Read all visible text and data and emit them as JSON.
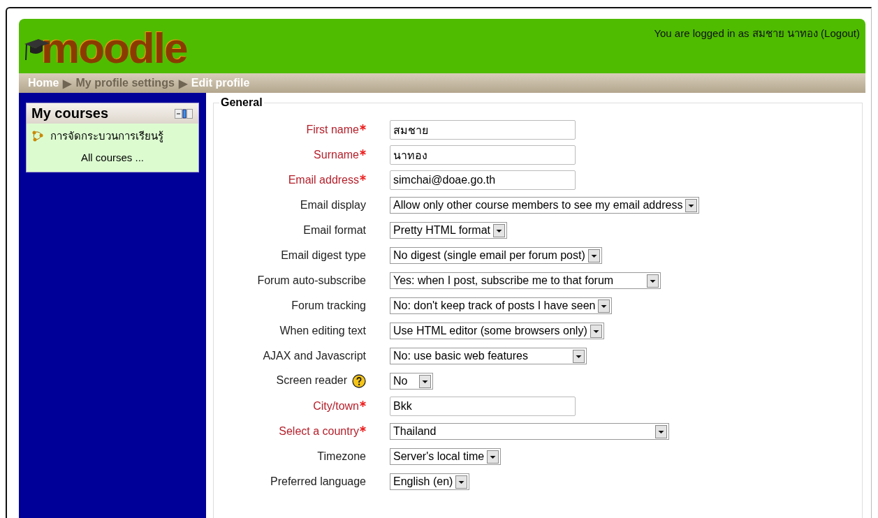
{
  "header": {
    "logo": "moodle",
    "login_info": "You are logged in as สมชาย นาทอง (Logout)"
  },
  "breadcrumb": [
    {
      "text": "Home",
      "dimmed": false
    },
    {
      "text": "▶",
      "dimmed": true
    },
    {
      "text": "My profile settings",
      "dimmed": true
    },
    {
      "text": "▶",
      "dimmed": true
    },
    {
      "text": "Edit profile",
      "dimmed": false
    }
  ],
  "sidebar": {
    "block_title": "My courses",
    "courses": [
      "การจัดกระบวนการเรียนรู้"
    ],
    "all_courses": "All courses ..."
  },
  "form": {
    "legend": "General",
    "fields": [
      {
        "label": "First name",
        "required": true,
        "kind": "text",
        "value": "สมชาย"
      },
      {
        "label": "Surname",
        "required": true,
        "kind": "text",
        "value": "นาทอง"
      },
      {
        "label": "Email address",
        "required": true,
        "kind": "text",
        "value": "simchai@doae.go.th"
      },
      {
        "label": "Email display",
        "required": false,
        "kind": "select",
        "value": "Allow only other course members to see my email address"
      },
      {
        "label": "Email format",
        "required": false,
        "kind": "select",
        "value": "Pretty HTML format"
      },
      {
        "label": "Email digest type",
        "required": false,
        "kind": "select",
        "value": "No digest (single email per forum post)"
      },
      {
        "label": "Forum auto-subscribe",
        "required": false,
        "kind": "select",
        "value": "Yes: when I post, subscribe me to that forum"
      },
      {
        "label": "Forum tracking",
        "required": false,
        "kind": "select",
        "value": "No: don't keep track of posts I have seen"
      },
      {
        "label": "When editing text",
        "required": false,
        "kind": "select",
        "value": "Use HTML editor (some browsers only)"
      },
      {
        "label": "AJAX and Javascript",
        "required": false,
        "kind": "select",
        "value": "No: use basic web features"
      },
      {
        "label": "Screen reader",
        "required": false,
        "kind": "select",
        "value": "No",
        "help": true
      },
      {
        "label": "City/town",
        "required": true,
        "kind": "text",
        "value": "Bkk"
      },
      {
        "label": "Select a country",
        "required": true,
        "kind": "select",
        "value": "Thailand"
      },
      {
        "label": "Timezone",
        "required": false,
        "kind": "select",
        "value": "Server's local time"
      },
      {
        "label": "Preferred language",
        "required": false,
        "kind": "select",
        "value": "English (en)"
      }
    ]
  }
}
